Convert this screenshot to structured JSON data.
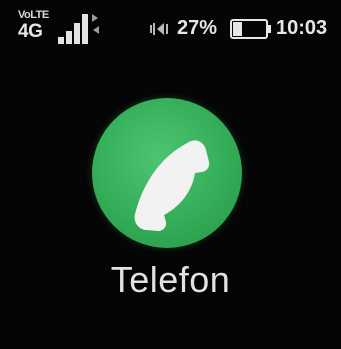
{
  "status_bar": {
    "volte_label": "VoLTE",
    "network_type": "4G",
    "signal_level": 0.75,
    "signal_icon": "signal-bars-icon",
    "data_activity_icon": "data-arrows-icon",
    "mute_icon": "vibrate-mute-icon",
    "battery_percent": "27%",
    "battery_level": 0.27,
    "battery_icon": "battery-icon",
    "time": "10:03"
  },
  "app": {
    "name": "Telefon",
    "icon": "phone-handset-icon",
    "icon_color": "#33ad57",
    "glyph_color": "#f2f2f2"
  },
  "colors": {
    "background": "#050505",
    "text": "#e2e2e2"
  }
}
